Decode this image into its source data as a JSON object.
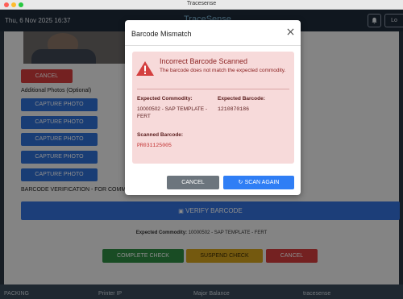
{
  "window": {
    "title": "Tracesense",
    "colors": {
      "close": "#ff5f57",
      "minimize": "#febc2e",
      "zoom": "#28c840"
    }
  },
  "header": {
    "datetime": "Thu, 6 Nov 2025 16:37",
    "logo": "TraceSense",
    "bell_icon": "bell-icon",
    "logout_label": "Lo"
  },
  "main": {
    "cancel_label": "CANCEL",
    "additional_photos_label": "Additional Photos (Optional)",
    "capture_buttons": [
      "CAPTURE PHOTO",
      "CAPTURE PHOTO",
      "CAPTURE PHOTO",
      "CAPTURE PHOTO",
      "CAPTURE PHOTO"
    ],
    "barcode_section_label": "BARCODE VERIFICATION - FOR COMMO",
    "verify_label": "VERIFY BARCODE",
    "expected_prefix": "Expected Commodity:",
    "expected_value": "10000502 - SAP TEMPLATE - FERT",
    "complete_label": "COMPLETE CHECK",
    "suspend_label": "SUSPEND CHECK",
    "cancel2_label": "CANCEL",
    "colors": {
      "complete": "#2e8b43",
      "suspend": "#d4a21d",
      "cancel": "#d33d3d",
      "verify": "#3472dc"
    }
  },
  "footer": {
    "items": [
      "PACKING",
      "Printer IP",
      "Major Balance",
      "tracesense"
    ]
  },
  "modal": {
    "title": "Barcode Mismatch",
    "close_icon": "close-icon",
    "alert_title": "Incorrect Barcode Scanned",
    "alert_desc": "The barcode does not match the expected commodity.",
    "expected_commodity_label": "Expected Commodity:",
    "expected_commodity_value": "10000502 - SAP TEMPLATE - FERT",
    "expected_barcode_label": "Expected Barcode:",
    "expected_barcode_value": "1210870186",
    "scanned_barcode_label": "Scanned Barcode:",
    "scanned_barcode_value": "PR031125005",
    "cancel_label": "CANCEL",
    "scan_again_label": "SCAN AGAIN",
    "colors": {
      "cancel": "#6c757d",
      "scan_again": "#2f7ef5",
      "alert_bg": "#f7dada",
      "warning": "#d43f3f"
    }
  }
}
